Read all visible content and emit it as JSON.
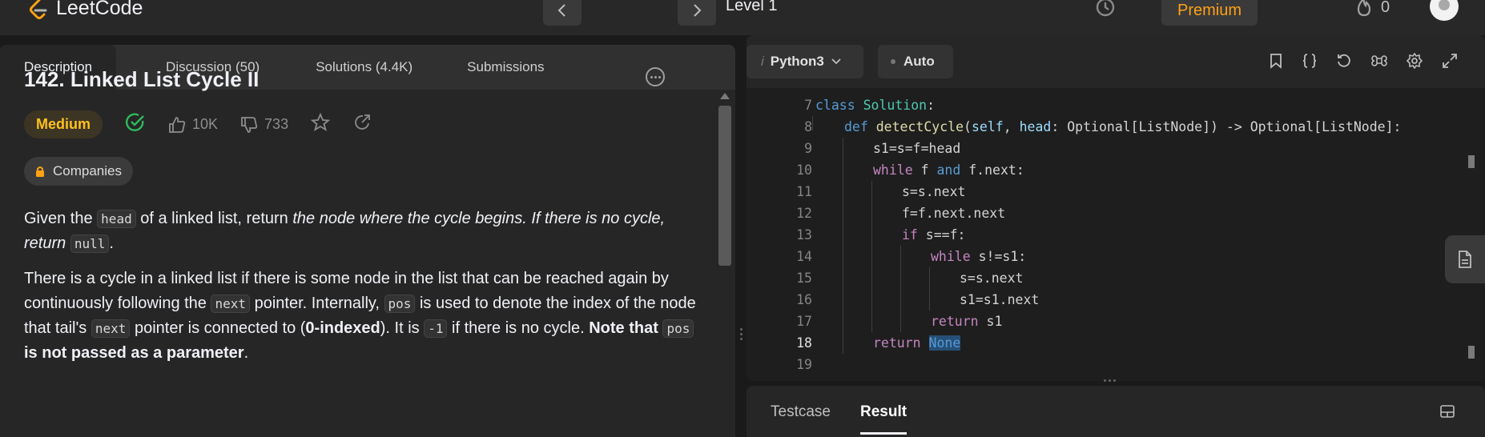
{
  "header": {
    "logo_text": "LeetCode",
    "level_label": "Level 1",
    "premium_label": "Premium",
    "streak_count": "0"
  },
  "tabs": [
    {
      "label": "Description"
    },
    {
      "label": "Discussion (50)"
    },
    {
      "label": "Solutions (4.4K)"
    },
    {
      "label": "Submissions"
    }
  ],
  "problem": {
    "title": "142. Linked List Cycle II",
    "difficulty": "Medium",
    "likes": "10K",
    "dislikes": "733",
    "companies_label": "Companies",
    "p1_a": "Given the ",
    "p1_code1": "head",
    "p1_b": " of a linked list, return ",
    "p1_em": "the node where the cycle begins. If there is no cycle, return ",
    "p1_code2": "null",
    "p1_c": ".",
    "p2_a": "There is a cycle in a linked list if there is some node in the list that can be reached again by continuously following the ",
    "p2_code1": "next",
    "p2_b": " pointer. Internally, ",
    "p2_code2": "pos",
    "p2_c": " is used to denote the index of the node that tail's ",
    "p2_code3": "next",
    "p2_d": " pointer is connected to (",
    "p2_bold1": "0-indexed",
    "p2_e": "). It is ",
    "p2_code4": "-1",
    "p2_f": " if there is no cycle. ",
    "p2_bold2a": "Note that ",
    "p2_code5": "pos",
    "p2_bold2b": " is not passed as a parameter",
    "p2_g": "."
  },
  "editor": {
    "language": "Python3",
    "language_prefix": "i",
    "mode": "Auto",
    "line_numbers": [
      "7",
      "8",
      "9",
      "10",
      "11",
      "12",
      "13",
      "14",
      "15",
      "16",
      "17",
      "18",
      "19"
    ],
    "code": {
      "l7_kw": "class",
      "l7_cls": "Solution",
      "l7_rest": ":",
      "l8_kw": "def",
      "l8_fn": "detectCycle",
      "l8_p1": "self",
      "l8_p2": "head",
      "l8_rest": ": Optional[ListNode]) -> Optional[ListNode]:",
      "l9": "s1=s=f=head",
      "l10_kw": "while",
      "l10_a": " f ",
      "l10_and": "and",
      "l10_b": " f.next:",
      "l11": "s=s.next",
      "l12": "f=f.next.next",
      "l13_kw": "if",
      "l13_rest": " s==f:",
      "l14_kw": "while",
      "l14_rest": " s!=s1:",
      "l15": "s=s.next",
      "l16": "s1=s1.next",
      "l17_kw": "return",
      "l17_rest": " s1",
      "l18_kw": "return",
      "l18_none": "None"
    }
  },
  "console": {
    "tabs": [
      {
        "label": "Testcase"
      },
      {
        "label": "Result"
      }
    ]
  }
}
